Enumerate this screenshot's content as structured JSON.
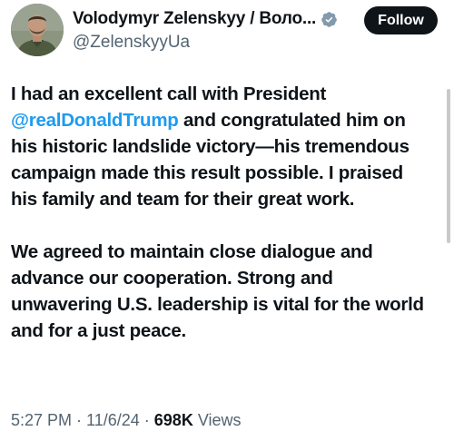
{
  "author": {
    "display_name": "Volodymyr Zelenskyy / Воло...",
    "handle": "@ZelenskyyUa",
    "verified_badge_icon": "verified-badge-icon",
    "badge_color": "#829aab"
  },
  "follow_button": {
    "label": "Follow"
  },
  "tweet": {
    "paragraph1_before": "I had an excellent call with President ",
    "mention": "@realDonaldTrump",
    "paragraph1_after": " and congratulated him on his historic landslide victory—his tremendous campaign made this result possible. I praised his family and team for their great work.",
    "paragraph2": "We agreed to maintain close dialogue and advance our cooperation. Strong and unwavering U.S. leadership is vital for the world and for a just peace."
  },
  "meta": {
    "time": "5:27 PM",
    "separator1": " · ",
    "date": "11/6/24",
    "separator2": " · ",
    "views_count": "698K",
    "views_label": " Views"
  },
  "colors": {
    "text": "#0f1419",
    "secondary": "#536471",
    "link": "#1d9bf0",
    "follow_bg": "#0f1419"
  }
}
